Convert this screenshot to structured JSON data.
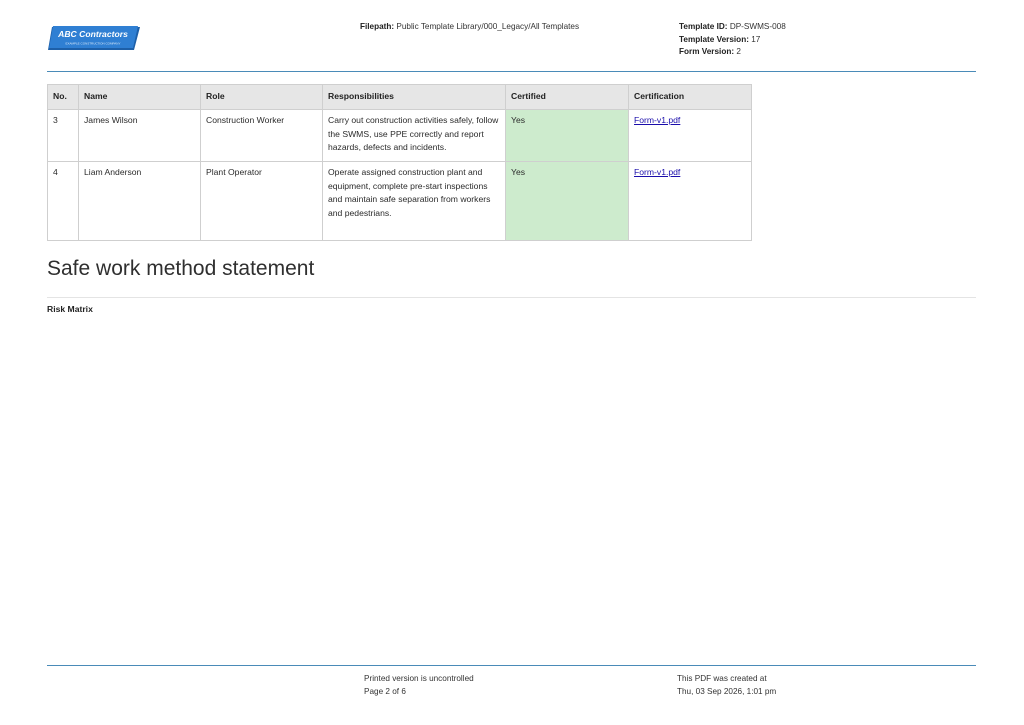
{
  "header": {
    "logo": {
      "name": "ABC Contractors",
      "tagline": "EXAMPLE CONSTRUCTION COMPANY",
      "colors": {
        "bg": "#2f7fd3",
        "bg_dark": "#1d5fa8",
        "text": "#ffffff"
      }
    },
    "filepath_label": "Filepath:",
    "filepath_value": "Public Template Library/000_Legacy/All Templates",
    "template_id_label": "Template ID:",
    "template_id_value": "DP-SWMS-008",
    "template_version_label": "Template Version:",
    "template_version_value": "17",
    "form_version_label": "Form Version:",
    "form_version_value": "2"
  },
  "table": {
    "columns": [
      "No.",
      "Name",
      "Role",
      "Responsibilities",
      "Certified",
      "Certification"
    ],
    "rows": [
      {
        "no": "3",
        "name": "James Wilson",
        "role": "Construction Worker",
        "responsibilities": "Carry out construction activities safely, follow the SWMS, use PPE correctly and report hazards, defects and incidents.",
        "certified": "Yes",
        "certification": "Form-v1.pdf"
      },
      {
        "no": "4",
        "name": "Liam Anderson",
        "role": "Plant Operator",
        "responsibilities": "Operate assigned construction plant and equipment, complete pre-start inspections and maintain safe separation from workers and pedestrians.",
        "certified": "Yes",
        "certification": "Form-v1.pdf"
      }
    ],
    "colors": {
      "header_bg": "#e6e6e6",
      "certified_bg": "#cdebcd",
      "link": "#1a0dab"
    }
  },
  "section": {
    "title": "Safe work method statement",
    "subtitle": "Risk Matrix"
  },
  "footer": {
    "uncontrolled": "Printed version is uncontrolled",
    "page": "Page 2 of 6",
    "created_label": "This PDF was created at",
    "created_at": "Thu, 03 Sep 2026, 1:01 pm"
  },
  "accent_color": "#4a8bb8"
}
